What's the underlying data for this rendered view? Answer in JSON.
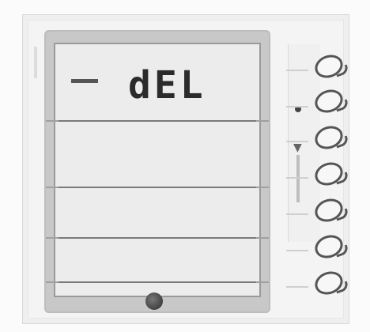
{
  "display": {
    "text": "dEL"
  },
  "buttons": [
    {
      "icon": "button-icon"
    },
    {
      "icon": "button-icon"
    },
    {
      "icon": "button-icon"
    },
    {
      "icon": "button-icon"
    },
    {
      "icon": "button-icon"
    },
    {
      "icon": "button-icon"
    },
    {
      "icon": "button-icon"
    }
  ],
  "colors": {
    "lcd_text": "#2b2b2b",
    "frame": "#c8c8c8",
    "screen": "#ececec"
  }
}
